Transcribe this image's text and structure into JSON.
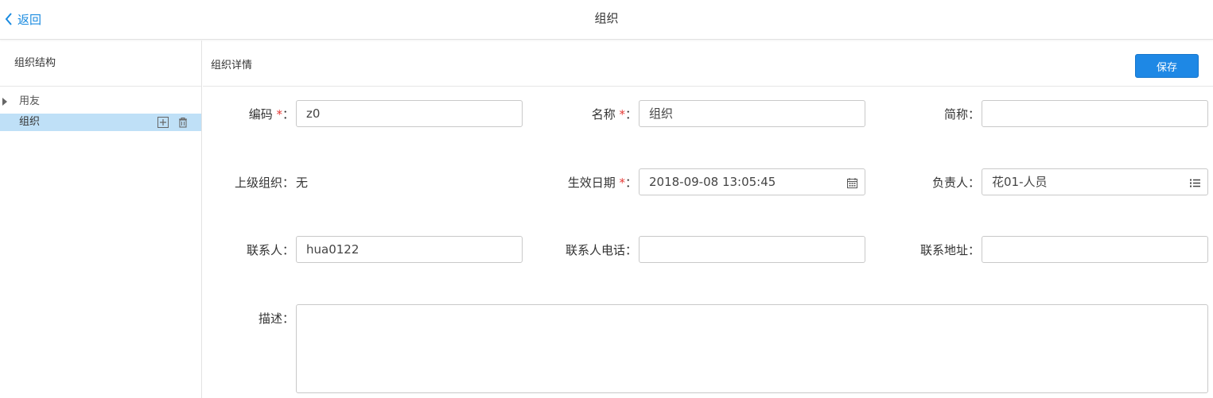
{
  "topbar": {
    "back_label": "返回",
    "title": "组织"
  },
  "left_panel": {
    "title": "组织结构",
    "tree": [
      {
        "label": "用友",
        "expanded": false
      },
      {
        "label": "组织",
        "selected": true
      }
    ]
  },
  "right_panel": {
    "title": "组织详情",
    "save_label": "保存"
  },
  "form": {
    "code": {
      "label": "编码",
      "required": true,
      "colon": "：",
      "value": "z0"
    },
    "name": {
      "label": "名称",
      "required": true,
      "colon": "：",
      "value": "组织"
    },
    "short_name": {
      "label": "简称",
      "colon": "：",
      "value": ""
    },
    "parent_org": {
      "label": "上级组织",
      "colon": "：",
      "value": "无"
    },
    "effective_date": {
      "label": "生效日期",
      "required": true,
      "colon": "：",
      "value": "2018-09-08 13:05:45",
      "icon": "calendar-icon"
    },
    "owner": {
      "label": "负责人",
      "colon": "：",
      "value": "花01-人员",
      "icon": "list-icon"
    },
    "contact": {
      "label": "联系人",
      "colon": "：",
      "value": "hua0122"
    },
    "contact_phone": {
      "label": "联系人电话",
      "colon": "：",
      "value": ""
    },
    "contact_address": {
      "label": "联系地址",
      "colon": "：",
      "value": ""
    },
    "description": {
      "label": "描述",
      "colon": "：",
      "value": ""
    }
  },
  "required_mark": "*",
  "colors": {
    "accent": "#1e88e5",
    "selected_row": "#bfe0f7",
    "required": "#e53935"
  }
}
